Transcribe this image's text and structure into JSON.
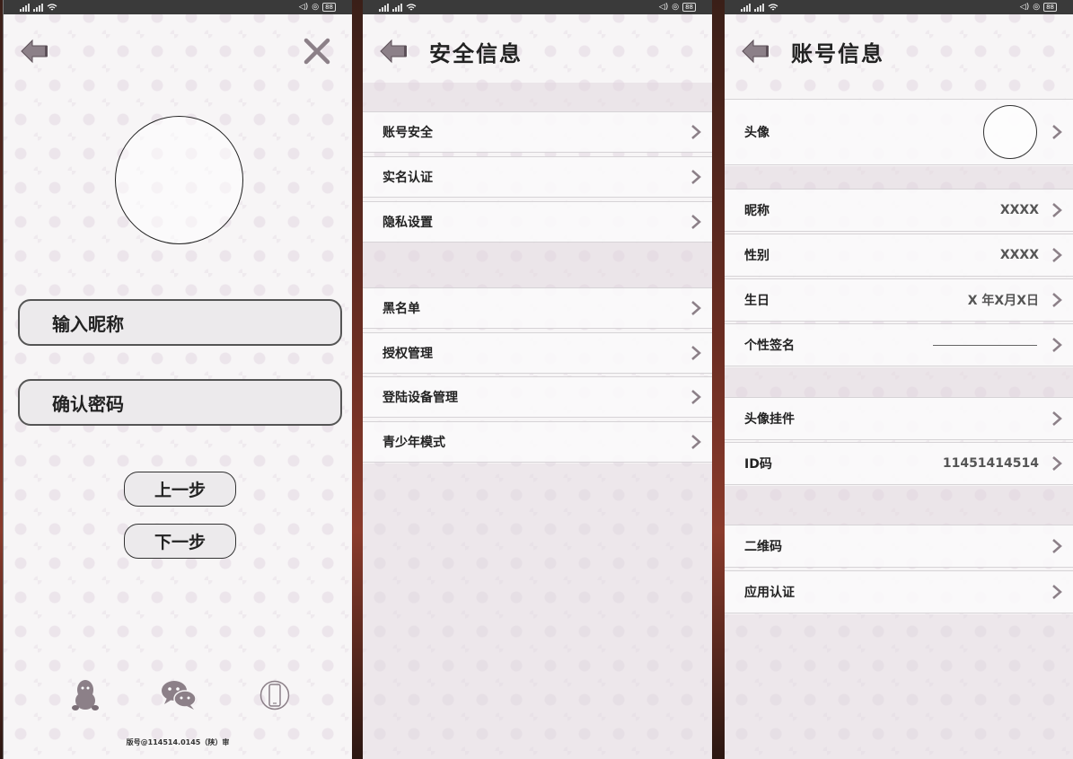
{
  "status_bar": {
    "battery": "88"
  },
  "register": {
    "nickname_placeholder": "输入昵称",
    "password_placeholder": "确认密码",
    "prev_label": "上一步",
    "next_label": "下一步",
    "footer": "版号@114514.0145（陕）审"
  },
  "security": {
    "title": "安全信息",
    "items": [
      "账号安全",
      "实名认证",
      "隐私设置",
      "黑名单",
      "授权管理",
      "登陆设备管理",
      "青少年模式"
    ]
  },
  "account": {
    "title": "账号信息",
    "avatar_label": "头像",
    "nickname_label": "昵称",
    "nickname_value": "XXXX",
    "gender_label": "性别",
    "gender_value": "XXXX",
    "birthday_label": "生日",
    "birthday_value": "X 年X月X日",
    "signature_label": "个性签名",
    "pendant_label": "头像挂件",
    "id_label": "ID码",
    "id_value": "11451414514",
    "qrcode_label": "二维码",
    "app_auth_label": "应用认证"
  },
  "colors": {
    "icon_gray": "#8c8088",
    "status_bar": "#3a3a3a",
    "accent_pattern": "#d7c8d7"
  }
}
